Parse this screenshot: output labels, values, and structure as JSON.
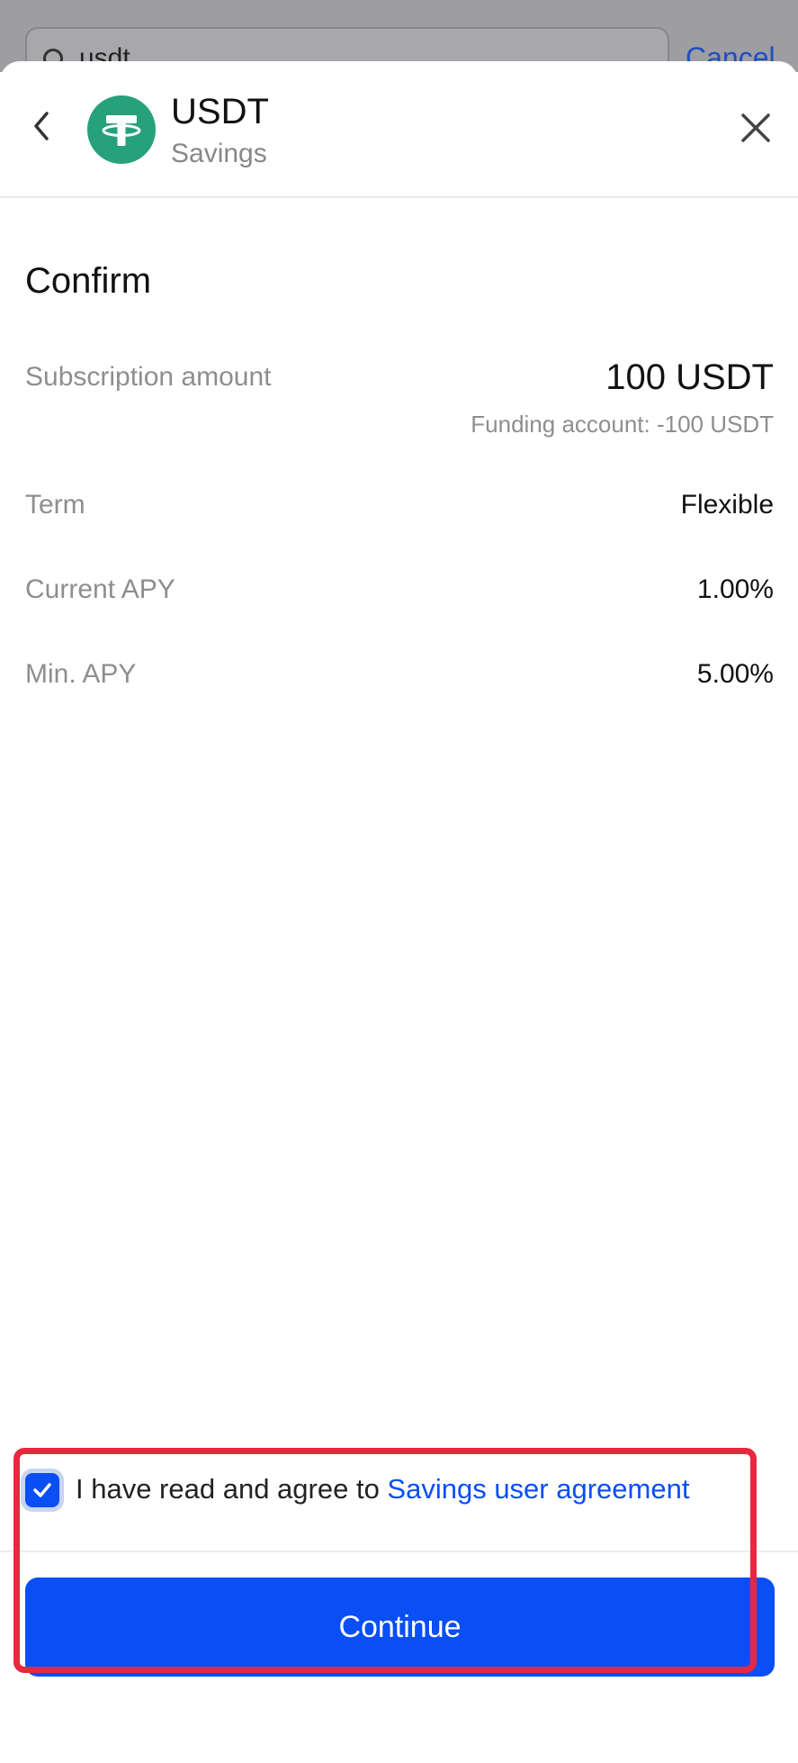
{
  "backdrop": {
    "search_value": "usdt",
    "cancel_label": "Cancel"
  },
  "header": {
    "coin_symbol": "USDT",
    "product": "Savings",
    "back_icon": "chevron-left-icon",
    "close_icon": "close-icon",
    "coin_icon": "tether-logo-icon"
  },
  "confirm": {
    "title": "Confirm",
    "rows": [
      {
        "label": "Subscription amount",
        "value": "100 USDT",
        "note": "Funding account: -100 USDT"
      },
      {
        "label": "Term",
        "value": "Flexible"
      },
      {
        "label": "Current APY",
        "value": "1.00%"
      },
      {
        "label": "Min. APY",
        "value": "5.00%"
      }
    ]
  },
  "agreement": {
    "checked": true,
    "text": "I have read and agree to ",
    "link": "Savings user agreement"
  },
  "actions": {
    "continue_label": "Continue"
  },
  "colors": {
    "accent": "#0a4ef5",
    "coin": "#26a17b",
    "highlight": "#e8283e"
  }
}
